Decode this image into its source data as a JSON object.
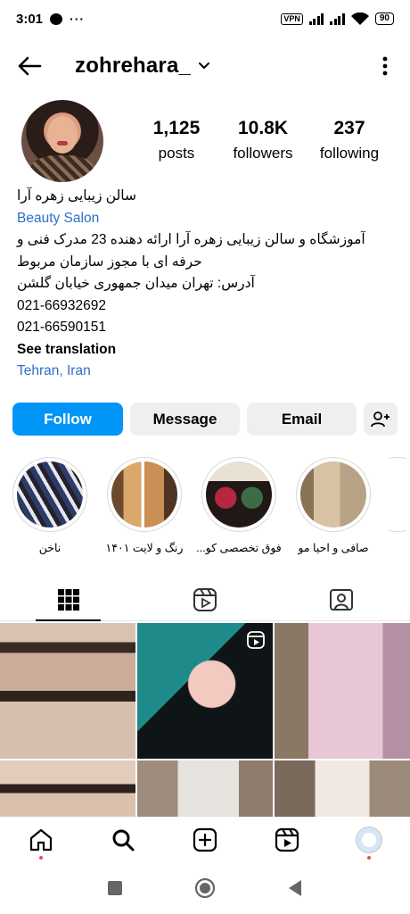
{
  "status_bar": {
    "time": "3:01",
    "more": "···",
    "vpn": "VPN",
    "battery": "90"
  },
  "header": {
    "username": "zohrehara_"
  },
  "profile": {
    "stats": [
      {
        "value": "1,125",
        "label": "posts"
      },
      {
        "value": "10.8K",
        "label": "followers"
      },
      {
        "value": "237",
        "label": "following"
      }
    ],
    "bio": {
      "name": "سالن زیبایی زهره آرا",
      "category": "Beauty Salon",
      "line1": "آموزشگاه و سالن زیبایی زهره آرا ارائه دهنده 23 مدرک فنی و",
      "line2": "حرفه ای با مجوز سازمان مربوط",
      "address": "آدرس: تهران میدان جمهوری خیابان گلشن",
      "phone1": "021-66932692",
      "phone2": "021-66590151",
      "see_translation": "See translation",
      "location": "Tehran, Iran"
    }
  },
  "actions": {
    "follow": "Follow",
    "message": "Message",
    "email": "Email"
  },
  "highlights": [
    {
      "label": "ناخن"
    },
    {
      "label": "رنگ و لایت ۱۴۰۱"
    },
    {
      "label": "فوق تخصصی کو..."
    },
    {
      "label": "صافی و احیا مو"
    }
  ],
  "colors": {
    "accent": "#0095f6",
    "link": "#2b6fc9",
    "notification": "#ed4956"
  },
  "icons": {
    "back": "arrow-left-icon",
    "menu": "vertical-dots-icon",
    "grid_tab": "grid-icon",
    "reels_tab": "reels-icon",
    "tagged_tab": "tagged-person-icon",
    "home": "home-icon",
    "search": "search-icon",
    "create": "plus-square-icon",
    "reels": "reels-icon"
  }
}
